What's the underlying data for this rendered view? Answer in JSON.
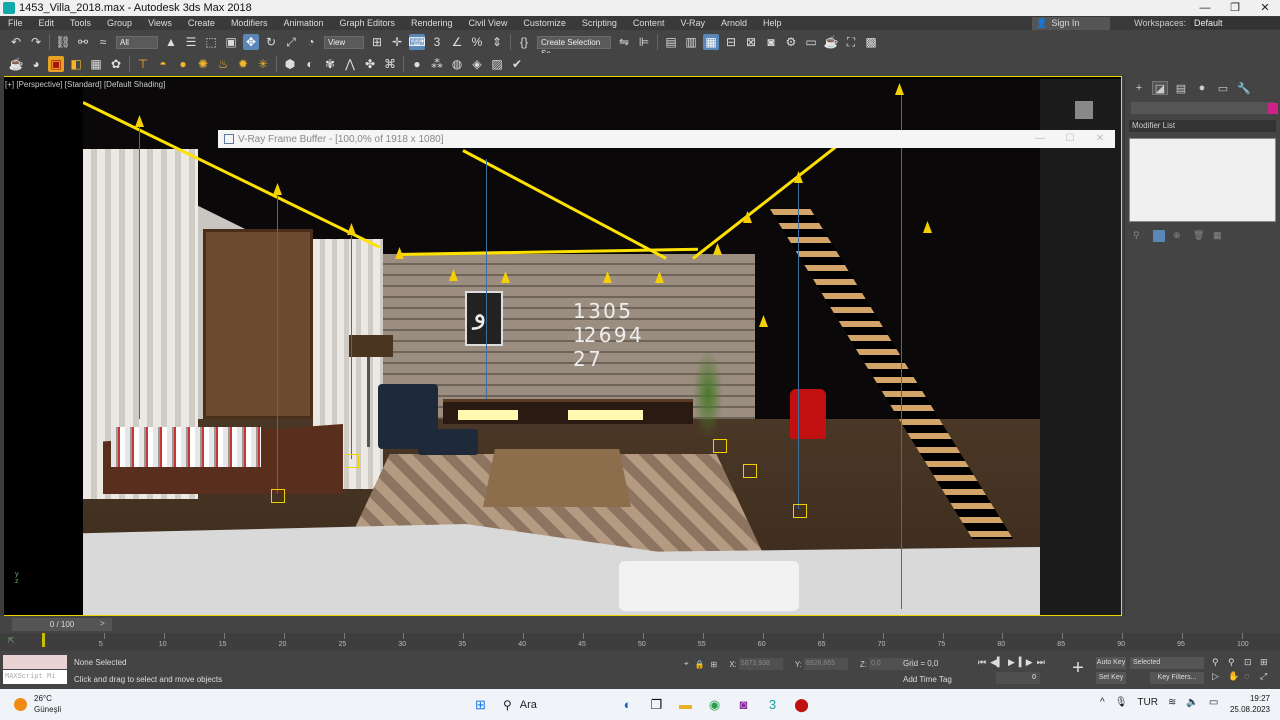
{
  "titlebar": {
    "title": "1453_Villa_2018.max - Autodesk 3ds Max 2018",
    "minimize": "—",
    "restore": "❐",
    "close": "✕"
  },
  "menubar": {
    "items": [
      "File",
      "Edit",
      "Tools",
      "Group",
      "Views",
      "Create",
      "Modifiers",
      "Animation",
      "Graph Editors",
      "Rendering",
      "Civil View",
      "Customize",
      "Scripting",
      "Content",
      "V-Ray",
      "Arnold",
      "Help"
    ],
    "signin": "Sign In",
    "workspaces_label": "Workspaces:",
    "workspaces_value": "Default"
  },
  "toolbar1": {
    "filter_value": "All",
    "view_value": "View",
    "selection_set_placeholder": "Create Selection Se"
  },
  "viewport": {
    "label": "[+] [Perspective] [Standard] [Default Shading]",
    "clock_text": "1 3 0 5 12 6 9 4 2 7"
  },
  "vfb": {
    "title": "V-Ray Frame Buffer - [100,0% of 1918 x 1080]",
    "minimize": "—",
    "maximize": "☐",
    "close": "✕"
  },
  "command_panel": {
    "modifier_list": "Modifier List"
  },
  "timeline": {
    "slider_text": "0 / 100",
    "ticks": [
      "5",
      "10",
      "15",
      "20",
      "25",
      "30",
      "35",
      "40",
      "45",
      "50",
      "55",
      "60",
      "65",
      "70",
      "75",
      "80",
      "85",
      "90",
      "95",
      "100"
    ]
  },
  "statusbar": {
    "maxscript": "MAXScript Mi",
    "selection_status": "None Selected",
    "prompt": "Click and drag to select and move objects",
    "x_label": "X:",
    "x_value": "5873,938",
    "y_label": "Y:",
    "y_value": "6926,665",
    "z_label": "Z:",
    "z_value": "0,0",
    "grid": "Grid = 0,0",
    "add_time_tag": "Add Time Tag",
    "frame_value": "0",
    "auto_key": "Auto Key",
    "set_key": "Set Key",
    "selected_dropdown": "Selected",
    "key_filters": "Key Filters..."
  },
  "taskbar": {
    "temperature": "26°C",
    "weather": "Güneşli",
    "search": "Ara",
    "lang": "TUR",
    "time": "19:27",
    "date": "25.08.2023"
  },
  "colors": {
    "viewport_border": "#f0d000",
    "light_gizmo": "#ffe100",
    "accent": "#5b86b8"
  }
}
